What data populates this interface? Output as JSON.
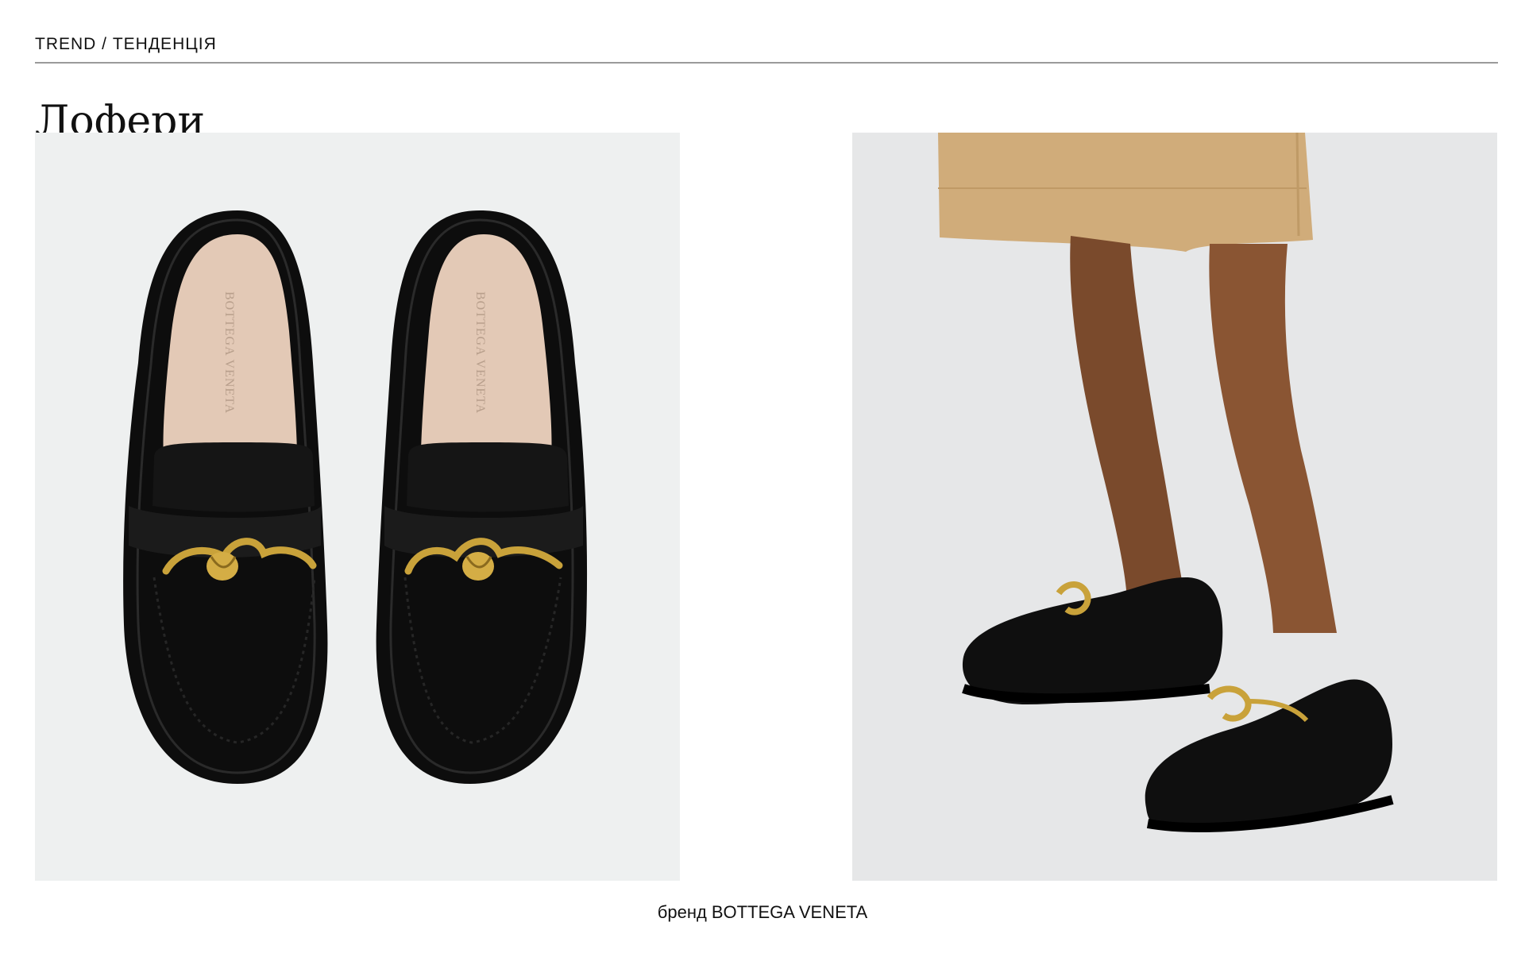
{
  "header": {
    "kicker": "TREND / ТЕНДЕНЦІЯ",
    "title": "Лофери"
  },
  "photos": {
    "left": {
      "insole_logo_left": "BOTTEGA VENETA",
      "insole_logo_right": "BOTTEGA VENETA"
    }
  },
  "caption": {
    "prefix": "бренд",
    "brand": "BOTTEGA VENETA"
  },
  "colors": {
    "leather": "#111111",
    "gold": "#c9a23a",
    "insole": "#e3c9b6",
    "skirt": "#d0ac7a",
    "skin": "#7a4a2c"
  }
}
